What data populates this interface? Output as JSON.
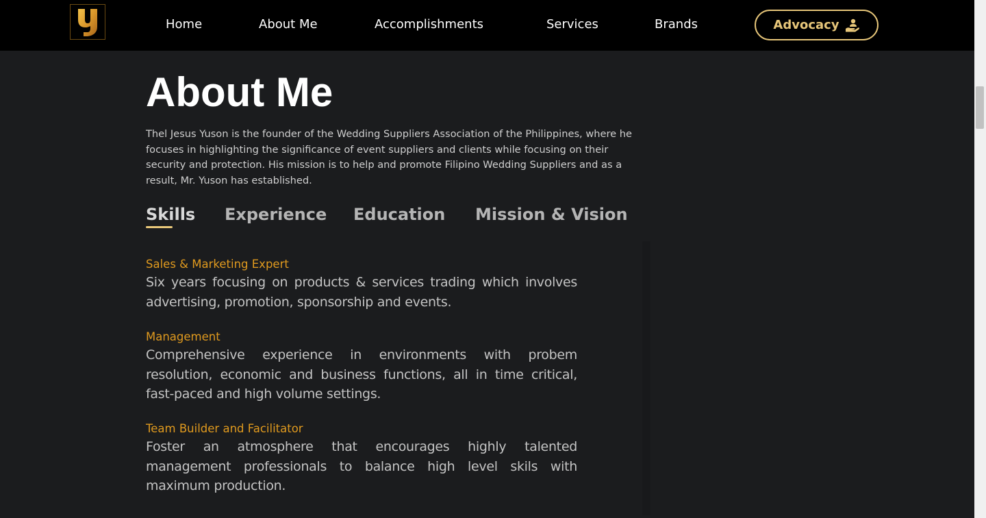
{
  "header": {
    "logo_letter": "y",
    "nav": [
      "Home",
      "About Me",
      "Accomplishments",
      "Services",
      "Brands"
    ],
    "advocacy_label": "Advocacy",
    "advocacy_icon": "hand-holding-person-icon",
    "accent": "#e8c77a"
  },
  "main": {
    "title": "About Me",
    "intro": "Thel Jesus Yuson is the founder of the Wedding Suppliers Association of the Philippines, where he focuses in highlighting the significance of event suppliers and clients while focusing on their security and protection. His mission is to help and promote Filipino Wedding Suppliers and as a result, Mr. Yuson has established.",
    "tabs": [
      "Skills",
      "Experience",
      "Education",
      "Mission & Vision"
    ],
    "active_tab": "Skills",
    "skills": [
      {
        "title": "Sales & Marketing Expert",
        "description": "Six years focusing on products & services trading which involves advertising, promotion, sponsorship and events."
      },
      {
        "title": "Management",
        "description": "Comprehensive experience in environments with probem resolution, economic and business functions, all in time critical, fast-paced and high volume settings."
      },
      {
        "title": "Team Builder and Facilitator",
        "description": "Foster an atmosphere that encourages highly talented management professionals to balance high level skils with maximum production."
      }
    ],
    "skill_title_color": "#e09a1e"
  }
}
